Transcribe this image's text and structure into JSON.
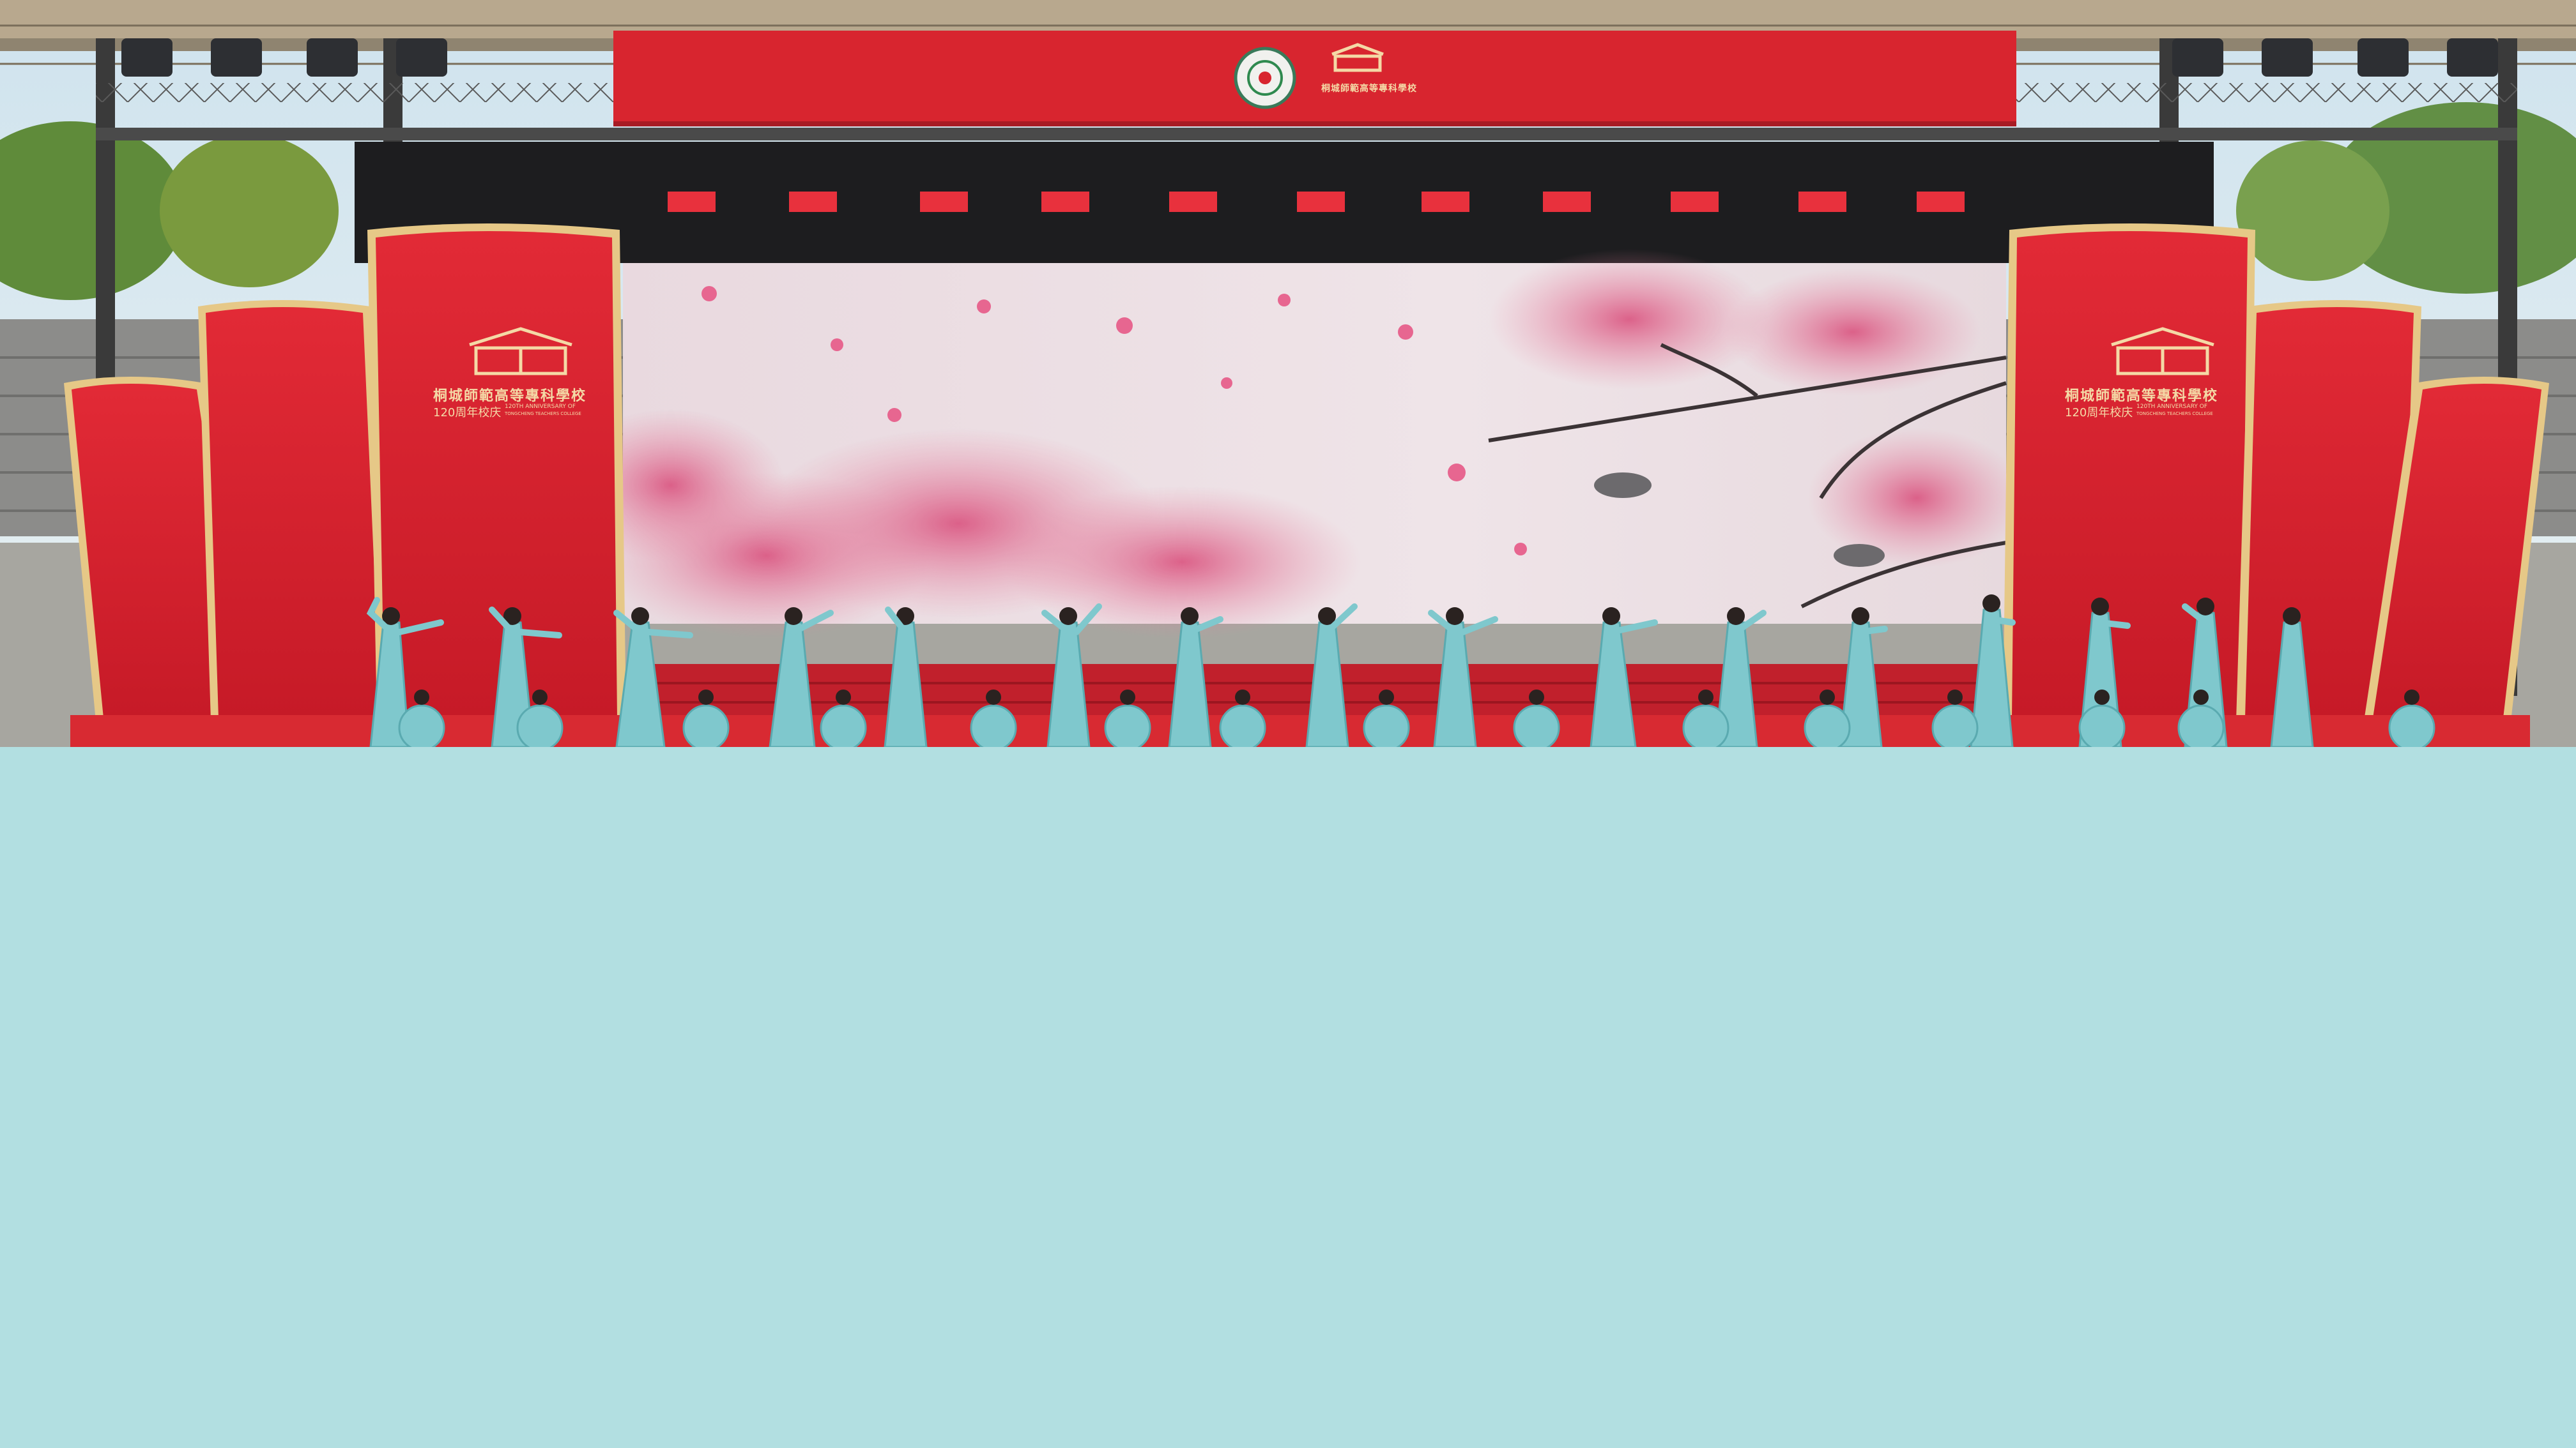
{
  "photo": {
    "subject": "stage dance performance",
    "colors": {
      "stage_red": "#d8212e",
      "gold_trim": "#e6c887",
      "costume_teal": "#7fc8cd",
      "screen_pink": "#e98aa5",
      "page_background": "#b2dfe1"
    }
  },
  "banner": {
    "emblem": "school-seal",
    "logo_text": "桐城師範高等專科學校"
  },
  "left_panel": {
    "school_name": "桐城師範高等專科學校",
    "anniversary": "120周年校庆",
    "english_line1": "120TH ANNIVERSARY OF",
    "english_line2": "TONGCHENG TEACHERS COLLEGE"
  },
  "right_panel": {
    "school_name": "桐城師範高等專科學校",
    "anniversary": "120周年校庆",
    "english_line1": "120TH ANNIVERSARY OF",
    "english_line2": "TONGCHENG TEACHERS COLLEGE"
  }
}
